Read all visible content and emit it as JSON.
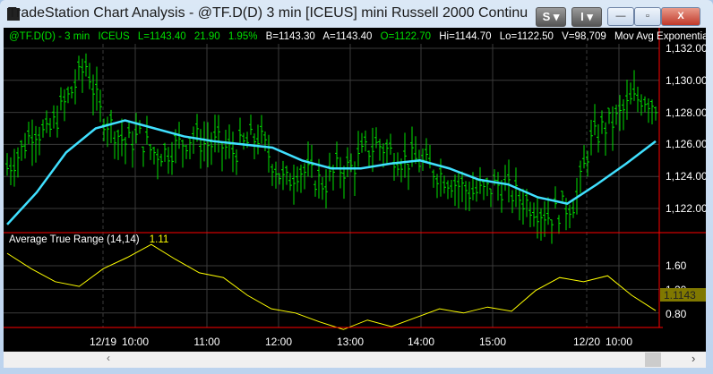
{
  "window": {
    "title": "TradeStation Chart Analysis - @TF.D(D) 3 min [ICEUS] mini Russell 2000 Continu",
    "s_button": "S",
    "i_button": "I",
    "minimize": "—",
    "maximize": "▫",
    "close": "X"
  },
  "header": {
    "symbol": "@TF.D(D) - 3 min",
    "exchange": "ICEUS",
    "last": "L=1143.40",
    "change": "21.90",
    "pct": "1.95%",
    "bid": "B=1143.30",
    "ask": "A=1143.40",
    "open": "O=1122.70",
    "high": "Hi=1144.70",
    "low": "Lo=1122.50",
    "volume": "V=98,709",
    "indicator": "Mov Avg Exponential ( ..."
  },
  "atr": {
    "label": "Average True Range (14,14)",
    "value": "1.11",
    "axis_marker": "1.1143"
  },
  "price_axis": [
    "1,132.00",
    "1,130.00",
    "1,128.00",
    "1,126.00",
    "1,124.00",
    "1,122.00"
  ],
  "atr_axis": [
    "1.60",
    "1.20",
    "0.80"
  ],
  "time_axis": [
    "12/19",
    "10:00",
    "11:00",
    "12:00",
    "13:00",
    "14:00",
    "15:00",
    "12/20",
    "10:00"
  ],
  "colors": {
    "bars": "#00e000",
    "ema": "#40e0ff",
    "atr": "#ffff00",
    "axis": "#ff0000"
  },
  "chart_data": {
    "type": "line",
    "price_close": [
      1124.5,
      1125.5,
      1127,
      1126.5,
      1128,
      1129.5,
      1131,
      1128,
      1127,
      1126,
      1126.5,
      1125.5,
      1125.5,
      1126,
      1126.5,
      1126,
      1126,
      1125.5,
      1126,
      1126.5,
      1125,
      1123.5,
      1124.5,
      1124,
      1123.5,
      1124.5,
      1124.5,
      1125.5,
      1126,
      1125.5,
      1125,
      1125,
      1124.5,
      1124,
      1123.5,
      1123,
      1123,
      1123.5,
      1123,
      1122.5,
      1122,
      1121.5,
      1122,
      1122.5,
      1126,
      1127,
      1127.5,
      1128.5,
      1129,
      1128.5
    ],
    "ema": [
      1121,
      1123,
      1125.5,
      1127,
      1127.5,
      1127,
      1126.5,
      1126.2,
      1126,
      1125.8,
      1125,
      1124.5,
      1124.5,
      1124.8,
      1125,
      1124.5,
      1123.8,
      1123.5,
      1122.7,
      1122.3,
      1123.5,
      1124.8,
      1126.2
    ],
    "atr": [
      1.81,
      1.55,
      1.33,
      1.25,
      1.55,
      1.74,
      1.96,
      1.71,
      1.48,
      1.4,
      1.1,
      0.87,
      0.8,
      0.65,
      0.52,
      0.68,
      0.57,
      0.72,
      0.87,
      0.8,
      0.9,
      0.83,
      1.18,
      1.4,
      1.33,
      1.43,
      1.1,
      0.84
    ],
    "price_ylim": [
      1120.5,
      1133
    ],
    "atr_ylim": [
      0.4,
      2.0
    ]
  }
}
